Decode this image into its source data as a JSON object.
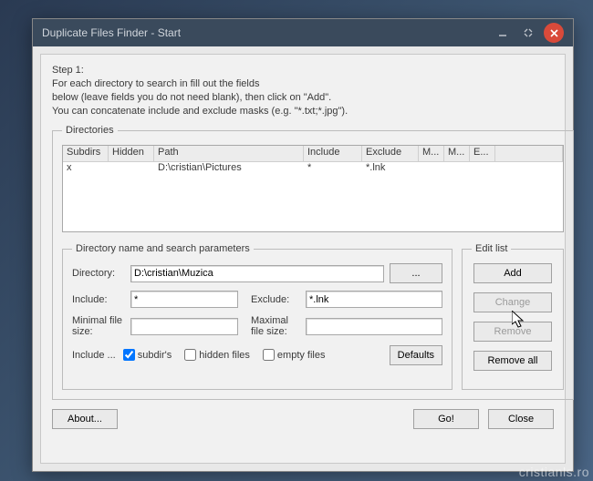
{
  "window": {
    "title": "Duplicate Files Finder - Start"
  },
  "instructions": {
    "step": "Step 1:",
    "line1": "For each directory to search in fill out the fields",
    "line2": "below (leave fields you do not need blank), then click on \"Add\".",
    "line3": "You can concatenate include and exclude masks (e.g. \"*.txt;*.jpg\")."
  },
  "directories": {
    "legend": "Directories",
    "columns": {
      "subdirs": "Subdirs",
      "hidden": "Hidden",
      "path": "Path",
      "include": "Include",
      "exclude": "Exclude",
      "min": "M...",
      "max": "M...",
      "empty": "E..."
    },
    "rows": [
      {
        "subdirs": "x",
        "hidden": "",
        "path": "D:\\cristian\\Pictures",
        "include": "*",
        "exclude": "*.lnk",
        "min": "",
        "max": "",
        "empty": ""
      }
    ]
  },
  "params": {
    "legend": "Directory name and search parameters",
    "directory_label": "Directory:",
    "directory_value": "D:\\cristian\\Muzica",
    "browse_label": "...",
    "include_label": "Include:",
    "include_value": "*",
    "exclude_label": "Exclude:",
    "exclude_value": "*.lnk",
    "minsize_label": "Minimal file size:",
    "minsize_value": "",
    "maxsize_label": "Maximal file size:",
    "maxsize_value": "",
    "include_prefix": "Include ...",
    "chk_subdirs": "subdir's",
    "chk_hidden": "hidden files",
    "chk_empty": "empty files",
    "defaults_label": "Defaults"
  },
  "editlist": {
    "legend": "Edit list",
    "add": "Add",
    "change": "Change",
    "remove": "Remove",
    "remove_all": "Remove all"
  },
  "bottom": {
    "about": "About...",
    "go": "Go!",
    "close": "Close"
  },
  "watermark": "cristianls.ro"
}
